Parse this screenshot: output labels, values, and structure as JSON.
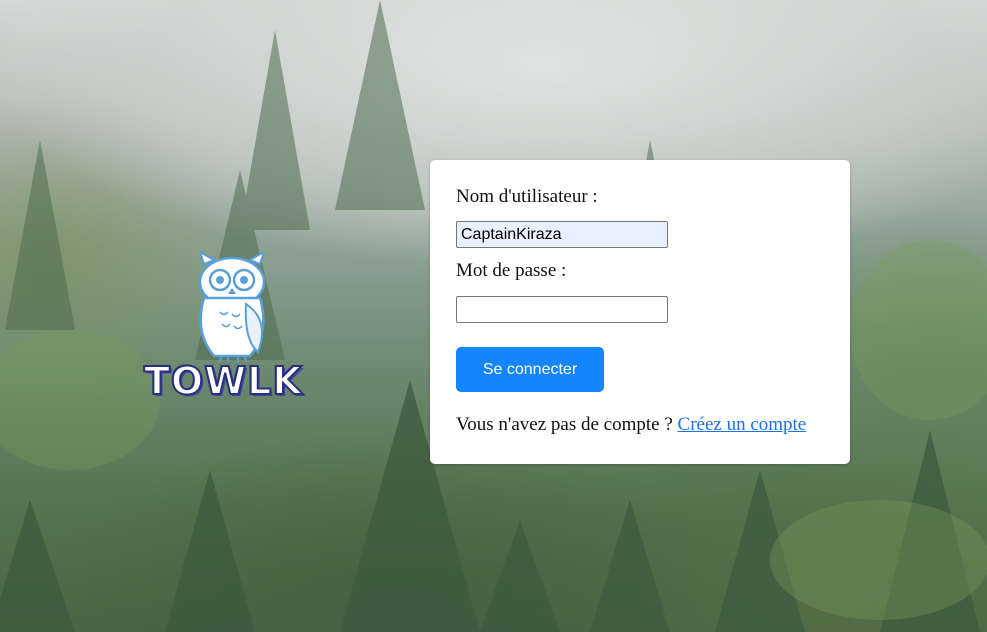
{
  "brand": {
    "logo_text": "TOWLK",
    "logo_icon": "owl-icon"
  },
  "login_form": {
    "username_label": "Nom d'utilisateur :",
    "username_value": "CaptainKiraza",
    "password_label": "Mot de passe :",
    "password_value": "",
    "submit_label": "Se connecter",
    "signup_prompt": "Vous n'avez pas de compte ?",
    "signup_link": "Créez un compte"
  },
  "colors": {
    "button": "#1485fb",
    "link": "#1a73e8",
    "autofill_bg": "#e8f0fe"
  }
}
